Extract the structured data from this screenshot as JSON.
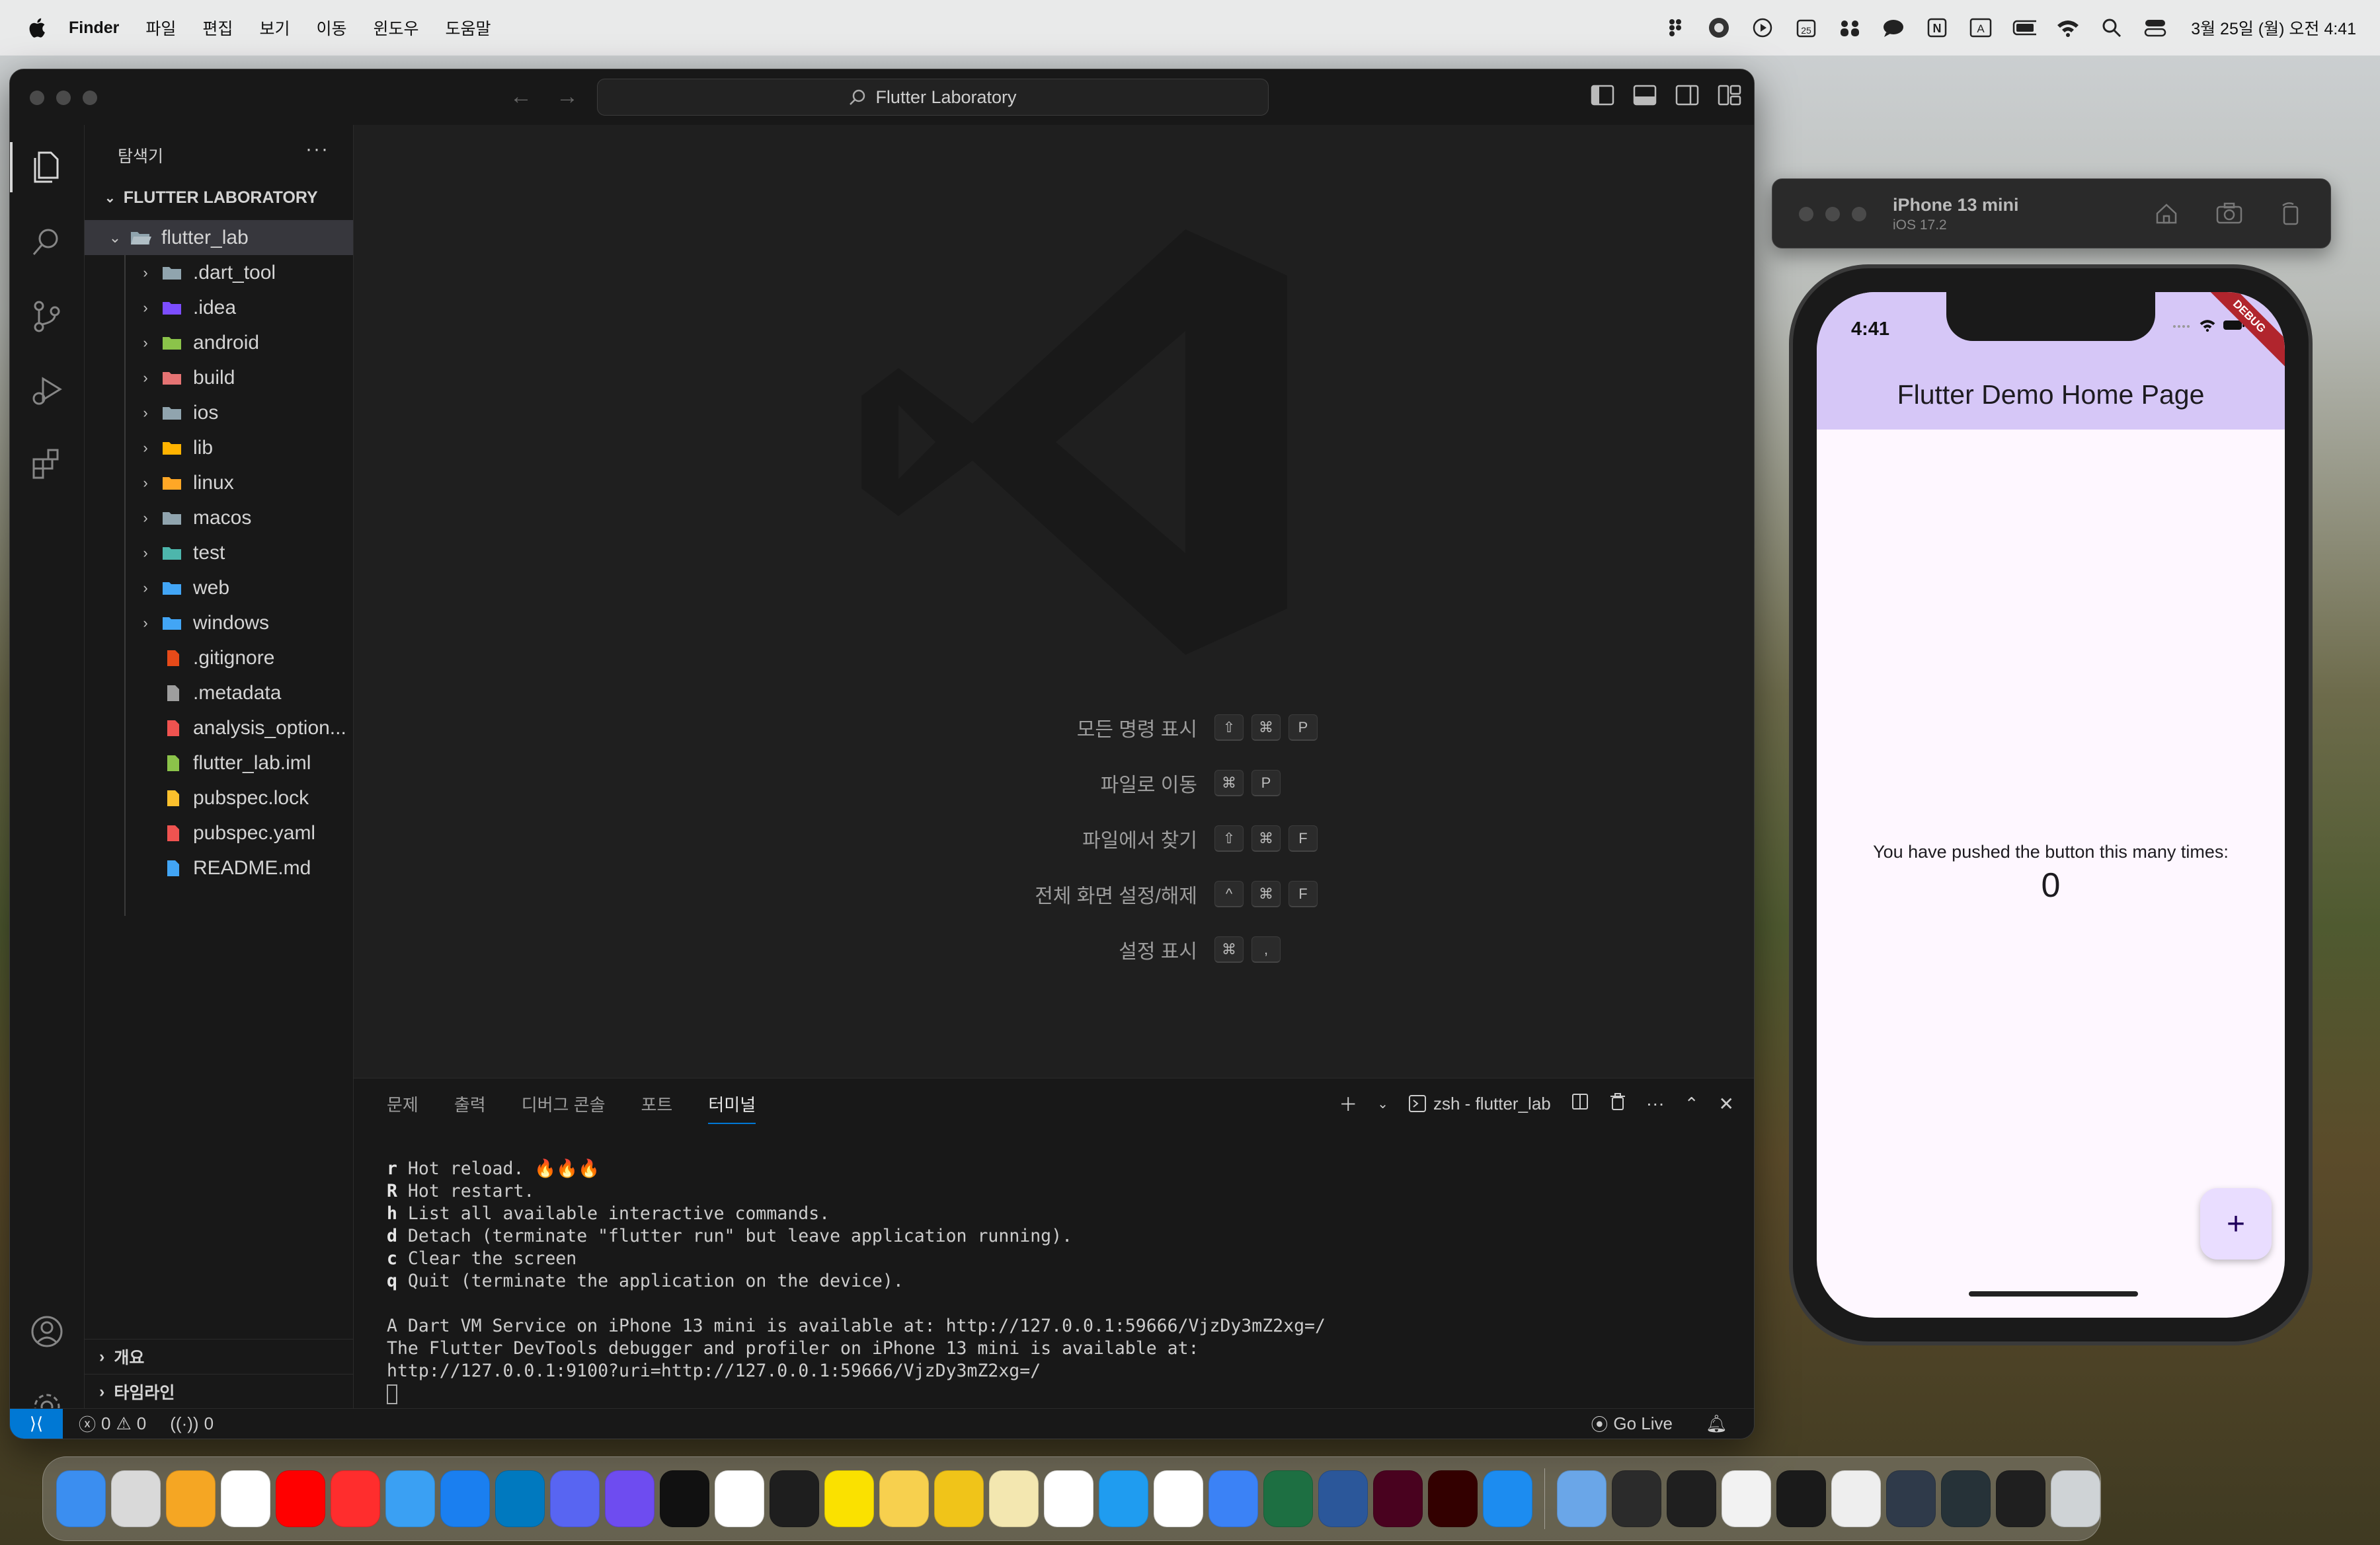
{
  "menubar": {
    "app_name": "Finder",
    "menus": [
      "파일",
      "편집",
      "보기",
      "이동",
      "윈도우",
      "도움말"
    ],
    "clock": "3월 25일 (월) 오전 4:41"
  },
  "vscode": {
    "command_center": "Flutter Laboratory",
    "explorer_title": "탐색기",
    "root_folder": "FLUTTER LABORATORY",
    "tree": [
      {
        "name": "flutter_lab",
        "type": "folder-open",
        "color": "#90a4ae"
      },
      {
        "name": ".dart_tool",
        "type": "folder",
        "color": "#90a4ae"
      },
      {
        "name": ".idea",
        "type": "folder",
        "color": "#7c4dff"
      },
      {
        "name": "android",
        "type": "folder",
        "color": "#8bc34a"
      },
      {
        "name": "build",
        "type": "folder",
        "color": "#e57373"
      },
      {
        "name": "ios",
        "type": "folder",
        "color": "#90a4ae"
      },
      {
        "name": "lib",
        "type": "folder",
        "color": "#ffb300"
      },
      {
        "name": "linux",
        "type": "folder",
        "color": "#ffa726"
      },
      {
        "name": "macos",
        "type": "folder",
        "color": "#90a4ae"
      },
      {
        "name": "test",
        "type": "folder",
        "color": "#4db6ac"
      },
      {
        "name": "web",
        "type": "folder",
        "color": "#42a5f5"
      },
      {
        "name": "windows",
        "type": "folder",
        "color": "#42a5f5"
      },
      {
        "name": ".gitignore",
        "type": "file",
        "color": "#e64a19"
      },
      {
        "name": ".metadata",
        "type": "file",
        "color": "#9e9e9e"
      },
      {
        "name": "analysis_option...",
        "type": "file",
        "color": "#ef5350"
      },
      {
        "name": "flutter_lab.iml",
        "type": "file",
        "color": "#8bc34a"
      },
      {
        "name": "pubspec.lock",
        "type": "file",
        "color": "#fbc02d"
      },
      {
        "name": "pubspec.yaml",
        "type": "file",
        "color": "#ef5350"
      },
      {
        "name": "README.md",
        "type": "file",
        "color": "#42a5f5"
      }
    ],
    "bottom_sections": [
      "개요",
      "타임라인"
    ],
    "shortcuts": [
      {
        "label": "모든 명령 표시",
        "keys": [
          "⇧",
          "⌘",
          "P"
        ]
      },
      {
        "label": "파일로 이동",
        "keys": [
          "⌘",
          "P"
        ]
      },
      {
        "label": "파일에서 찾기",
        "keys": [
          "⇧",
          "⌘",
          "F"
        ]
      },
      {
        "label": "전체 화면 설정/해제",
        "keys": [
          "^",
          "⌘",
          "F"
        ]
      },
      {
        "label": "설정 표시",
        "keys": [
          "⌘",
          ","
        ]
      }
    ],
    "panel_tabs": [
      "문제",
      "출력",
      "디버그 콘솔",
      "포트",
      "터미널"
    ],
    "terminal_name": "zsh - flutter_lab",
    "terminal_lines": [
      {
        "key": "r",
        "text": " Hot reload. 🔥🔥🔥"
      },
      {
        "key": "R",
        "text": " Hot restart."
      },
      {
        "key": "h",
        "text": " List all available interactive commands."
      },
      {
        "key": "d",
        "text": " Detach (terminate \"flutter run\" but leave application running)."
      },
      {
        "key": "c",
        "text": " Clear the screen"
      },
      {
        "key": "q",
        "text": " Quit (terminate the application on the device)."
      },
      {
        "key": "",
        "text": ""
      },
      {
        "key": "",
        "text": "A Dart VM Service on iPhone 13 mini is available at: http://127.0.0.1:59666/VjzDy3mZ2xg=/"
      },
      {
        "key": "",
        "text": "The Flutter DevTools debugger and profiler on iPhone 13 mini is available at:"
      },
      {
        "key": "",
        "text": "http://127.0.0.1:9100?uri=http://127.0.0.1:59666/VjzDy3mZ2xg=/"
      }
    ],
    "status": {
      "errors": "0",
      "warnings": "0",
      "ports": "0",
      "go_live": "Go Live"
    }
  },
  "simulator": {
    "device": "iPhone 13 mini",
    "os": "iOS 17.2",
    "time": "4:41",
    "app_title": "Flutter Demo Home Page",
    "debug_banner": "DEBUG",
    "counter_label": "You have pushed the button this many times:",
    "counter_value": "0",
    "fab": "+"
  },
  "dock": {
    "apps": [
      {
        "name": "finder",
        "color": "#3b8ef0"
      },
      {
        "name": "launchpad",
        "color": "#d9d9d9"
      },
      {
        "name": "photos",
        "color": "#f5a623"
      },
      {
        "name": "chrome",
        "color": "#ffffff"
      },
      {
        "name": "youtube",
        "color": "#ff0000"
      },
      {
        "name": "youtube-music",
        "color": "#ff2d2d"
      },
      {
        "name": "safari",
        "color": "#3aa0f3"
      },
      {
        "name": "app-store",
        "color": "#1a7ff0"
      },
      {
        "name": "trello",
        "color": "#0079bf"
      },
      {
        "name": "discord",
        "color": "#5865f2"
      },
      {
        "name": "chat",
        "color": "#6e4cf0"
      },
      {
        "name": "terminal",
        "color": "#111111"
      },
      {
        "name": "notion",
        "color": "#ffffff"
      },
      {
        "name": "figma",
        "color": "#1e1e1e"
      },
      {
        "name": "kakaotalk",
        "color": "#fae100"
      },
      {
        "name": "notes",
        "color": "#f7d04e"
      },
      {
        "name": "wave",
        "color": "#f0c419"
      },
      {
        "name": "stickies",
        "color": "#f3e7b0"
      },
      {
        "name": "capcut",
        "color": "#ffffff"
      },
      {
        "name": "vscode",
        "color": "#1f9cf0"
      },
      {
        "name": "slack",
        "color": "#ffffff"
      },
      {
        "name": "translator",
        "color": "#3b82f6"
      },
      {
        "name": "excel",
        "color": "#1d6f42"
      },
      {
        "name": "word",
        "color": "#2b579a"
      },
      {
        "name": "indesign",
        "color": "#49021f"
      },
      {
        "name": "illustrator",
        "color": "#330000"
      },
      {
        "name": "xcode",
        "color": "#1c8cf0"
      }
    ],
    "docs": [
      {
        "name": "downloads",
        "color": "#6aa6e8"
      },
      {
        "name": "window-1",
        "color": "#2b2b2b"
      },
      {
        "name": "window-2",
        "color": "#1f1f1f"
      },
      {
        "name": "window-3",
        "color": "#f2f2f2"
      },
      {
        "name": "window-4",
        "color": "#1a1a1a"
      },
      {
        "name": "window-5",
        "color": "#eeeeee"
      },
      {
        "name": "window-6",
        "color": "#2f3a4a"
      },
      {
        "name": "window-7",
        "color": "#263238"
      },
      {
        "name": "window-8",
        "color": "#1f1f1f"
      },
      {
        "name": "trash",
        "color": "#cfd3d6"
      }
    ]
  }
}
